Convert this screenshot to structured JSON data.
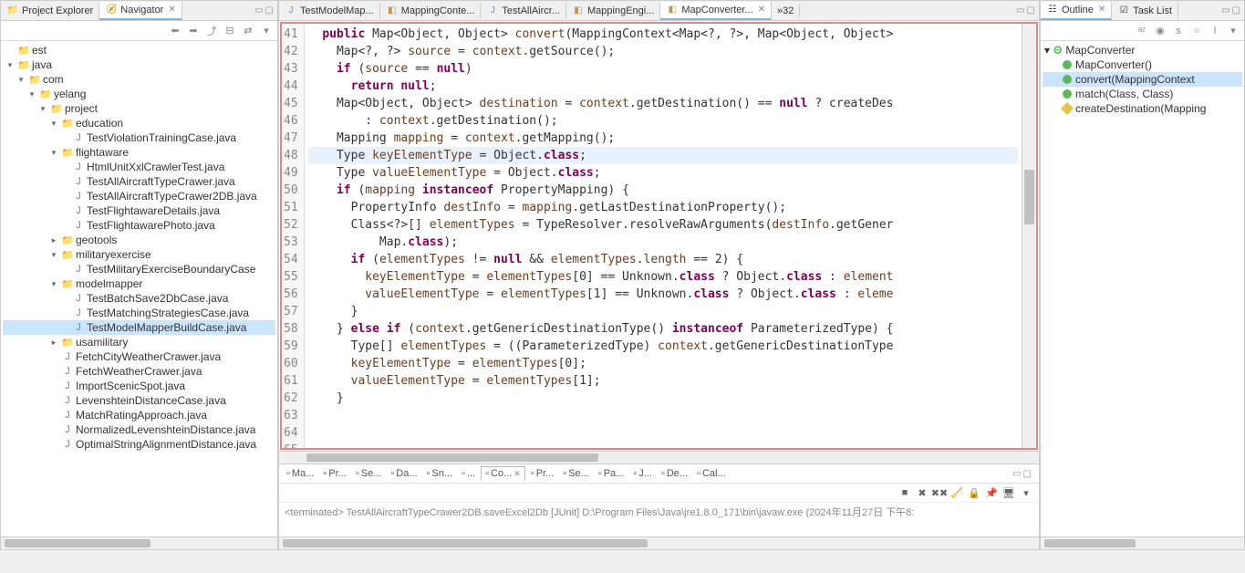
{
  "left_views": {
    "project_explorer": "Project Explorer",
    "navigator": "Navigator"
  },
  "editor_tabs": [
    {
      "label": "TestModelMap...",
      "icon": "J"
    },
    {
      "label": "MappingConte...",
      "icon": "cls"
    },
    {
      "label": "TestAllAircr...",
      "icon": "J"
    },
    {
      "label": "MappingEngi...",
      "icon": "cls"
    },
    {
      "label": "MapConverter...",
      "icon": "cls",
      "active": true
    }
  ],
  "editor_more": "»32",
  "right_views": {
    "outline": "Outline",
    "tasklist": "Task List"
  },
  "tree": [
    {
      "l": 0,
      "ic": "folder",
      "exp": "",
      "t": "est"
    },
    {
      "l": 0,
      "ic": "folder",
      "exp": "▾",
      "t": "java"
    },
    {
      "l": 1,
      "ic": "folder",
      "exp": "▾",
      "t": "com"
    },
    {
      "l": 2,
      "ic": "folder",
      "exp": "▾",
      "t": "yelang"
    },
    {
      "l": 3,
      "ic": "folder",
      "exp": "▾",
      "t": "project"
    },
    {
      "l": 4,
      "ic": "folder",
      "exp": "▾",
      "t": "education"
    },
    {
      "l": 5,
      "ic": "java",
      "exp": "",
      "t": "TestViolationTrainingCase.java"
    },
    {
      "l": 4,
      "ic": "folder",
      "exp": "▾",
      "t": "flightaware"
    },
    {
      "l": 5,
      "ic": "java",
      "exp": "",
      "t": "HtmlUnitXxlCrawlerTest.java"
    },
    {
      "l": 5,
      "ic": "java",
      "exp": "",
      "t": "TestAllAircraftTypeCrawer.java"
    },
    {
      "l": 5,
      "ic": "java",
      "exp": "",
      "t": "TestAllAircraftTypeCrawer2DB.java"
    },
    {
      "l": 5,
      "ic": "java",
      "exp": "",
      "t": "TestFlightawareDetails.java"
    },
    {
      "l": 5,
      "ic": "java",
      "exp": "",
      "t": "TestFlightawarePhoto.java"
    },
    {
      "l": 4,
      "ic": "folder",
      "exp": "▸",
      "t": "geotools"
    },
    {
      "l": 4,
      "ic": "folder",
      "exp": "▾",
      "t": "militaryexercise"
    },
    {
      "l": 5,
      "ic": "java",
      "exp": "",
      "t": "TestMilitaryExerciseBoundaryCase"
    },
    {
      "l": 4,
      "ic": "folder",
      "exp": "▾",
      "t": "modelmapper"
    },
    {
      "l": 5,
      "ic": "java",
      "exp": "",
      "t": "TestBatchSave2DbCase.java"
    },
    {
      "l": 5,
      "ic": "java",
      "exp": "",
      "t": "TestMatchingStrategiesCase.java"
    },
    {
      "l": 5,
      "ic": "java",
      "exp": "",
      "t": "TestModelMapperBuildCase.java",
      "sel": true
    },
    {
      "l": 4,
      "ic": "folder",
      "exp": "▸",
      "t": "usamilitary"
    },
    {
      "l": 4,
      "ic": "java",
      "exp": "",
      "t": "FetchCityWeatherCrawer.java"
    },
    {
      "l": 4,
      "ic": "java",
      "exp": "",
      "t": "FetchWeatherCrawer.java"
    },
    {
      "l": 4,
      "ic": "java",
      "exp": "",
      "t": "ImportScenicSpot.java"
    },
    {
      "l": 4,
      "ic": "java",
      "exp": "",
      "t": "LevenshteinDistanceCase.java"
    },
    {
      "l": 4,
      "ic": "java",
      "exp": "",
      "t": "MatchRatingApproach.java"
    },
    {
      "l": 4,
      "ic": "java",
      "exp": "",
      "t": "NormalizedLevenshteinDistance.java"
    },
    {
      "l": 4,
      "ic": "java",
      "exp": "",
      "t": "OptimalStringAlignmentDistance.java"
    }
  ],
  "code_start_line": 41,
  "code_lines": [
    "  <kw>public</kw> Map&lt;Object, Object&gt; <field>convert</field>(MappingContext&lt;Map&lt;?, ?&gt;, Map&lt;Object, Object&gt;",
    "    Map&lt;?, ?&gt; <field>source</field> = <field>context</field>.getSource();",
    "    <kw>if</kw> (<field>source</field> == <kw>null</kw>)",
    "      <kw>return null</kw>;",
    "",
    "    Map&lt;Object, Object&gt; <field>destination</field> = <field>context</field>.getDestination() == <kw>null</kw> ? createDes",
    "        : <field>context</field>.getDestination();",
    "    Mapping <field>mapping</field> = <field>context</field>.getMapping();",
    "",
    "    Type <field>keyElementType</field> = Object.<kw>class</kw>;",
    "    Type <field>valueElementType</field> = Object.<kw>class</kw>;",
    "    <kw>if</kw> (<field>mapping</field> <kw>instanceof</kw> PropertyMapping) {",
    "      PropertyInfo <field>destInfo</field> = <field>mapping</field>.getLastDestinationProperty();",
    "      Class&lt;?&gt;[] <field>elementTypes</field> = TypeResolver.resolveRawArguments(<field>destInfo</field>.getGener",
    "          Map.<kw>class</kw>);",
    "      <kw>if</kw> (<field>elementTypes</field> != <kw>null</kw> &amp;&amp; <field>elementTypes</field>.<field>length</field> == 2) {",
    "        <field>keyElementType</field> = <field>elementTypes</field>[0] == Unknown.<kw>class</kw> ? Object.<kw>class</kw> : <field>element</field>",
    "        <field>valueElementType</field> = <field>elementTypes</field>[1] == Unknown.<kw>class</kw> ? Object.<kw>class</kw> : <field>eleme</field>",
    "      }",
    "    } <kw>else if</kw> (<field>context</field>.getGenericDestinationType() <kw>instanceof</kw> ParameterizedType) {",
    "      Type[] <field>elementTypes</field> = ((ParameterizedType) <field>context</field>.getGenericDestinationType",
    "      <field>keyElementType</field> = <field>elementTypes</field>[0];",
    "      <field>valueElementType</field> = <field>elementTypes</field>[1];",
    "    }",
    ""
  ],
  "highlighted_line": 50,
  "outline": {
    "class": "MapConverter",
    "members": [
      {
        "k": "constructor",
        "t": "MapConverter()"
      },
      {
        "k": "method",
        "t": "convert(MappingContext<M",
        "sel": true
      },
      {
        "k": "method",
        "t": "match(Class<?>, Class<?>)"
      },
      {
        "k": "private",
        "t": "createDestination(Mapping"
      }
    ]
  },
  "bottom_tabs": [
    {
      "t": "Ma..."
    },
    {
      "t": "Pr..."
    },
    {
      "t": "Se..."
    },
    {
      "t": "Da..."
    },
    {
      "t": "Sn..."
    },
    {
      "t": "..."
    },
    {
      "t": "Co...",
      "active": true
    },
    {
      "t": "Pr..."
    },
    {
      "t": "Se..."
    },
    {
      "t": "Pa..."
    },
    {
      "t": "J..."
    },
    {
      "t": "De..."
    },
    {
      "t": "Cal..."
    }
  ],
  "console_command": "<terminated> TestAllAircraftTypeCrawer2DB.saveExcel2Db [JUnit] D:\\Program Files\\Java\\jre1.8.0_171\\bin\\javaw.exe (2024年11月27日 下午8:"
}
